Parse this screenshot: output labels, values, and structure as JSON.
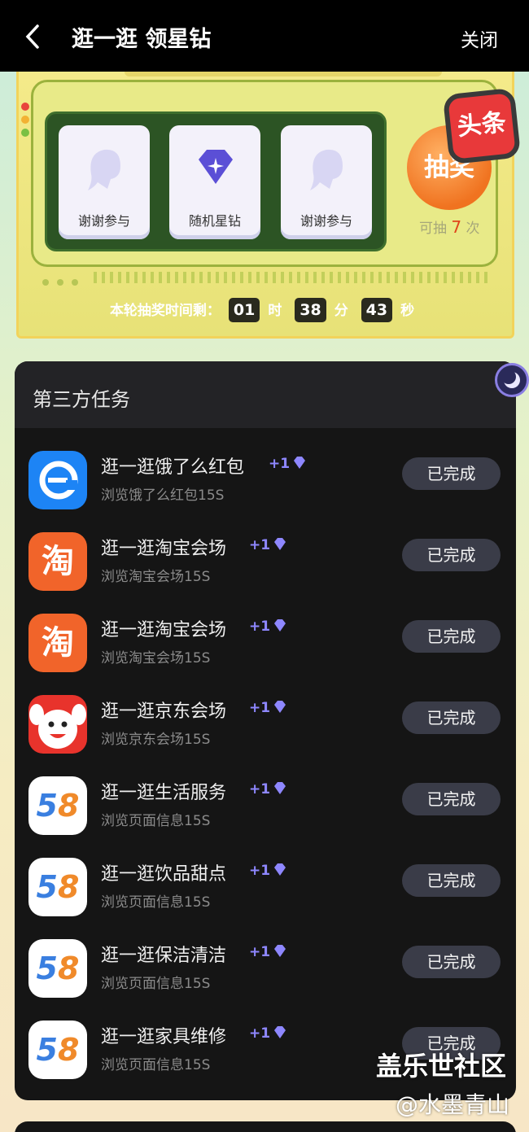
{
  "header": {
    "title": "逛一逛 领星钻",
    "close_label": "关闭"
  },
  "lottery": {
    "prizes": [
      {
        "label": "谢谢参与",
        "icon": "thanks-icon"
      },
      {
        "label": "随机星钻",
        "icon": "diamond-icon"
      },
      {
        "label": "谢谢参与",
        "icon": "thanks-icon"
      }
    ],
    "draw_button_label": "抽奖",
    "draw_count_prefix": "可抽",
    "draw_count": "7",
    "draw_count_suffix": "次",
    "badge_label": "头条",
    "timer_label": "本轮抽奖时间剩：",
    "hours": "01",
    "hours_unit": "时",
    "minutes": "38",
    "minutes_unit": "分",
    "seconds": "43",
    "seconds_unit": "秒"
  },
  "tasks_section": {
    "title": "第三方任务",
    "reward_text": "+1",
    "done_label": "已完成",
    "items": [
      {
        "name": "逛一逛饿了么红包",
        "desc": "浏览饿了么红包15S",
        "icon": "eleme-icon"
      },
      {
        "name": "逛一逛淘宝会场",
        "desc": "浏览淘宝会场15S",
        "icon": "taobao-icon",
        "glyph": "淘"
      },
      {
        "name": "逛一逛淘宝会场",
        "desc": "浏览淘宝会场15S",
        "icon": "taobao-icon",
        "glyph": "淘"
      },
      {
        "name": "逛一逛京东会场",
        "desc": "浏览京东会场15S",
        "icon": "jd-icon"
      },
      {
        "name": "逛一逛生活服务",
        "desc": "浏览页面信息15S",
        "icon": "58-icon",
        "glyph": "58"
      },
      {
        "name": "逛一逛饮品甜点",
        "desc": "浏览页面信息15S",
        "icon": "58-icon",
        "glyph": "58"
      },
      {
        "name": "逛一逛保洁清洁",
        "desc": "浏览页面信息15S",
        "icon": "58-icon",
        "glyph": "58"
      },
      {
        "name": "逛一逛家具维修",
        "desc": "浏览页面信息15S",
        "icon": "58-icon",
        "glyph": "58"
      }
    ]
  },
  "watermark": {
    "line1": "盖乐世社区",
    "line2": "@水墨青山"
  },
  "colors": {
    "accent": "#8e87ff",
    "draw_button": "#f07320",
    "screen": "#2c5424"
  }
}
